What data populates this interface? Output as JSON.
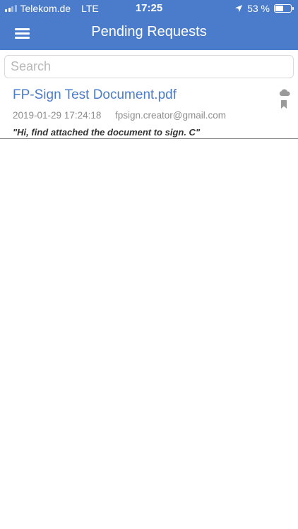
{
  "status_bar": {
    "carrier": "Telekom.de",
    "network": "LTE",
    "time": "17:25",
    "battery": "53 %",
    "battery_level": 0.53,
    "signal_bars": 4,
    "signal_bars_active": 2,
    "location_icon": "location-arrow-icon"
  },
  "navbar": {
    "title": "Pending Requests",
    "menu_icon": "hamburger-menu-icon"
  },
  "search": {
    "placeholder": "Search",
    "value": ""
  },
  "requests": [
    {
      "document_name": "FP-Sign Test Document.pdf",
      "date": "2019-01-29 17:24:18",
      "sender": "fpsign.creator@gmail.com",
      "message": "\"Hi, find attached the document to sign. C\"",
      "icons": [
        "cloud-icon",
        "bookmark-icon"
      ]
    }
  ],
  "colors": {
    "primary": "#4a7ccb",
    "meta_text": "#8d8d8d",
    "icon_gray": "#9a9a9a"
  }
}
